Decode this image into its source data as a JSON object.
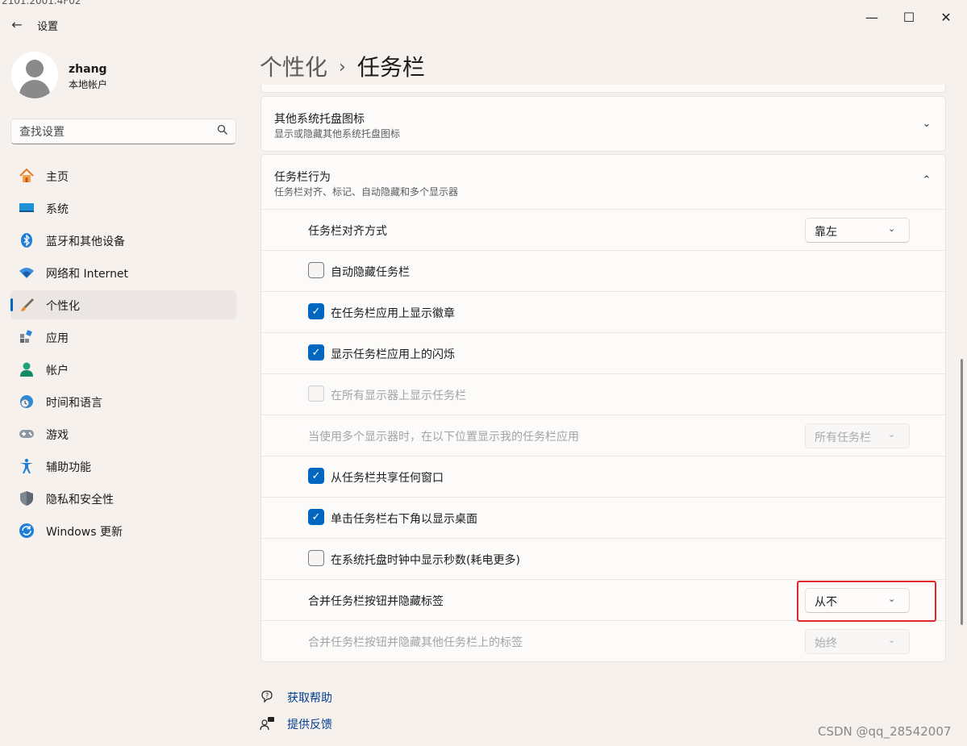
{
  "cut_text": "2101.2001.4F02",
  "window": {
    "title": "设置",
    "minimize": "—",
    "maximize": "☐",
    "close": "✕",
    "back": "←"
  },
  "user": {
    "name": "zhang",
    "type": "本地帐户"
  },
  "search": {
    "placeholder": "查找设置"
  },
  "nav": [
    {
      "label": "主页",
      "icon": "home-icon"
    },
    {
      "label": "系统",
      "icon": "system-icon"
    },
    {
      "label": "蓝牙和其他设备",
      "icon": "bluetooth-icon"
    },
    {
      "label": "网络和 Internet",
      "icon": "wifi-icon"
    },
    {
      "label": "个性化",
      "icon": "brush-icon",
      "active": true
    },
    {
      "label": "应用",
      "icon": "apps-icon"
    },
    {
      "label": "帐户",
      "icon": "account-icon"
    },
    {
      "label": "时间和语言",
      "icon": "clock-globe-icon"
    },
    {
      "label": "游戏",
      "icon": "gamepad-icon"
    },
    {
      "label": "辅助功能",
      "icon": "accessibility-icon"
    },
    {
      "label": "隐私和安全性",
      "icon": "shield-icon"
    },
    {
      "label": "Windows 更新",
      "icon": "update-icon"
    }
  ],
  "breadcrumb": {
    "parent": "个性化",
    "separator": "›",
    "current": "任务栏"
  },
  "tray_card": {
    "title": "其他系统托盘图标",
    "subtitle": "显示或隐藏其他系统托盘图标",
    "chevron": "⌄"
  },
  "behavior_card": {
    "title": "任务栏行为",
    "subtitle": "任务栏对齐、标记、自动隐藏和多个显示器",
    "chevron": "⌃",
    "align": {
      "label": "任务栏对齐方式",
      "value": "靠左"
    },
    "checkbox_mark": "✓",
    "checks": [
      {
        "label": "自动隐藏任务栏",
        "checked": false
      },
      {
        "label": "在任务栏应用上显示徽章",
        "checked": true
      },
      {
        "label": "显示任务栏应用上的闪烁",
        "checked": true
      },
      {
        "label": "在所有显示器上显示任务栏",
        "checked": false,
        "disabled": true
      }
    ],
    "multi_display": {
      "label": "当使用多个显示器时，在以下位置显示我的任务栏应用",
      "value": "所有任务栏"
    },
    "checks2": [
      {
        "label": "从任务栏共享任何窗口",
        "checked": true
      },
      {
        "label": "单击任务栏右下角以显示桌面",
        "checked": true
      },
      {
        "label": "在系统托盘时钟中显示秒数(耗电更多)",
        "checked": false
      }
    ],
    "combine": {
      "label": "合并任务栏按钮并隐藏标签",
      "value": "从不"
    },
    "combine_other": {
      "label": "合并任务栏按钮并隐藏其他任务栏上的标签",
      "value": "始终"
    }
  },
  "dropdown_chevron": "⌄",
  "links": {
    "help": "获取帮助",
    "feedback": "提供反馈"
  },
  "watermark": "CSDN @qq_28542007",
  "colors": {
    "accent": "#0067c0",
    "highlight": "#e3262a",
    "background": "#f7f1ee"
  }
}
